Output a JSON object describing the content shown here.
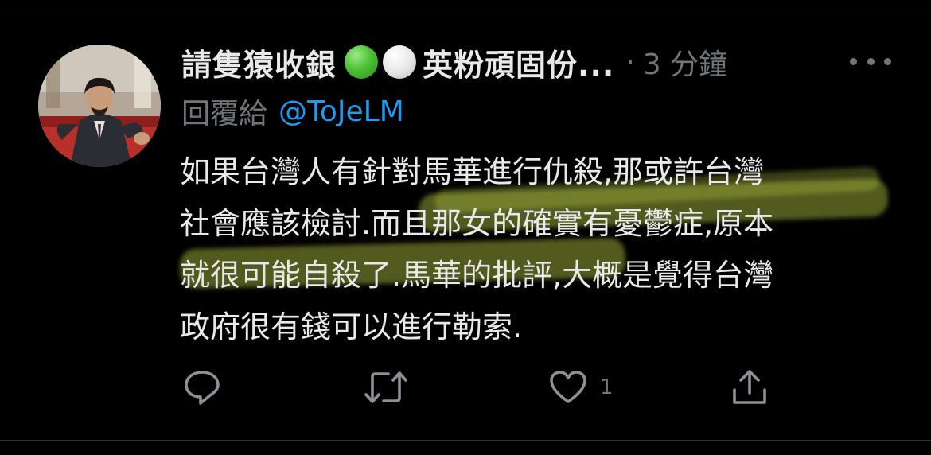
{
  "tweet": {
    "display_name": "請隻猿收銀",
    "display_name_suffix": "英粉頑固份...",
    "separator": "·",
    "timestamp": "3 分鐘",
    "reply_prefix": "回覆給",
    "reply_handle": "@ToJeLM",
    "body_lines": [
      "如果台灣人有針對馬華進行仇殺,那或許台灣",
      "社會應該檢討.而且那女的確實有憂鬱症,原本",
      "就很可能自殺了.馬華的批評,大概是覺得台灣",
      "政府很有錢可以進行勒索."
    ]
  },
  "actions": {
    "reply_icon": "reply-icon",
    "retweet_icon": "retweet-icon",
    "like_icon": "heart-icon",
    "like_count": "1",
    "share_icon": "share-icon"
  },
  "colors": {
    "background": "#000000",
    "text_primary": "#e7e9ea",
    "text_secondary": "#71767b",
    "link": "#1d9bf0",
    "highlight": "#c4d648",
    "status_green": "#4cc233",
    "status_white": "#e6e6e6"
  }
}
